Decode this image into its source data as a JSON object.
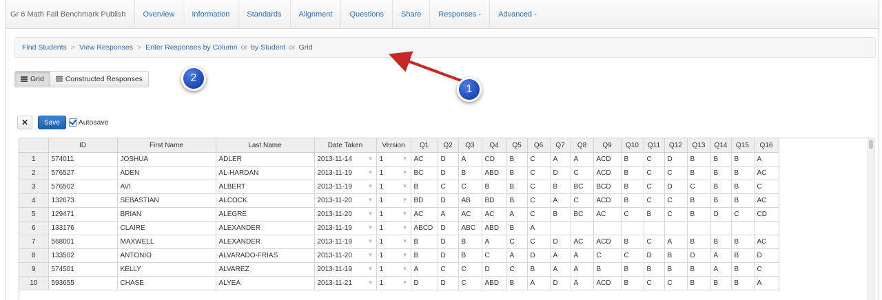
{
  "nav": {
    "title": "Gr 6 Math Fall Benchmark Publish",
    "items": [
      "Overview",
      "Information",
      "Standards",
      "Alignment",
      "Questions",
      "Share",
      "Responses -",
      "Advanced -"
    ]
  },
  "breadcrumb": {
    "find_students": "Find Students",
    "view_responses": "View Responses",
    "enter_by_column": "Enter Responses by Column",
    "or1": "or",
    "by_student": "by Student",
    "or2": "or",
    "grid": "Grid",
    "separator": ">"
  },
  "view_toggle": {
    "grid_label": "Grid",
    "constructed_label": "Constructed Responses"
  },
  "callouts": {
    "one": "1",
    "two": "2"
  },
  "toolbar": {
    "expand_icon": "✕",
    "save_label": "Save",
    "autosave_label": "Autosave",
    "autosave_checked": true
  },
  "grid": {
    "columns": [
      "",
      "ID",
      "First Name",
      "Last Name",
      "Date Taken",
      "Version",
      "Q1",
      "Q2",
      "Q3",
      "Q4",
      "Q5",
      "Q6",
      "Q7",
      "Q8",
      "Q9",
      "Q10",
      "Q11",
      "Q12",
      "Q13",
      "Q14",
      "Q15",
      "Q16"
    ],
    "rows": [
      [
        "1",
        "574011",
        "JOSHUA",
        "ADLER",
        "2013-11-14",
        "1",
        "AC",
        "D",
        "A",
        "CD",
        "B",
        "C",
        "A",
        "A",
        "ACD",
        "B",
        "C",
        "D",
        "B",
        "B",
        "B",
        "A"
      ],
      [
        "2",
        "576527",
        "ADEN",
        "AL-HARDAN",
        "2013-11-19",
        "1",
        "BC",
        "D",
        "B",
        "ABD",
        "B",
        "C",
        "D",
        "C",
        "ACD",
        "B",
        "C",
        "C",
        "B",
        "B",
        "B",
        "AC"
      ],
      [
        "3",
        "576502",
        "AVI",
        "ALBERT",
        "2013-11-19",
        "1",
        "B",
        "C",
        "C",
        "B",
        "B",
        "C",
        "B",
        "BC",
        "BCD",
        "B",
        "C",
        "D",
        "C",
        "B",
        "B",
        "C"
      ],
      [
        "4",
        "132673",
        "SEBASTIAN",
        "ALCOCK",
        "2013-11-20",
        "1",
        "BD",
        "D",
        "AB",
        "BD",
        "B",
        "C",
        "A",
        "C",
        "ACD",
        "B",
        "C",
        "C",
        "B",
        "B",
        "B",
        "AC"
      ],
      [
        "5",
        "129471",
        "BRIAN",
        "ALEGRE",
        "2013-11-20",
        "1",
        "AC",
        "A",
        "AC",
        "AC",
        "A",
        "C",
        "B",
        "BC",
        "AC",
        "C",
        "B",
        "C",
        "B",
        "D",
        "C",
        "CD"
      ],
      [
        "6",
        "133176",
        "CLAIRE",
        "ALEXANDER",
        "2013-11-19",
        "1",
        "ABCD",
        "D",
        "ABC",
        "ABD",
        "B",
        "A",
        "",
        "",
        "",
        "",
        "",
        "",
        "",
        "",
        "",
        ""
      ],
      [
        "7",
        "568001",
        "MAXWELL",
        "ALEXANDER",
        "2013-11-19",
        "1",
        "B",
        "D",
        "B",
        "A",
        "C",
        "C",
        "D",
        "AC",
        "ACD",
        "B",
        "C",
        "A",
        "B",
        "B",
        "B",
        "AC"
      ],
      [
        "8",
        "133502",
        "ANTONIO",
        "ALVARADO-FRIAS",
        "2013-11-20",
        "1",
        "B",
        "D",
        "B",
        "C",
        "A",
        "D",
        "A",
        "A",
        "C",
        "C",
        "D",
        "B",
        "D",
        "A",
        "B",
        "D"
      ],
      [
        "9",
        "574501",
        "KELLY",
        "ALVAREZ",
        "2013-11-19",
        "1",
        "A",
        "C",
        "C",
        "D",
        "C",
        "B",
        "A",
        "A",
        "B",
        "B",
        "B",
        "B",
        "B",
        "A",
        "B",
        "C"
      ],
      [
        "10",
        "593655",
        "CHASE",
        "ALYEA",
        "2013-11-21",
        "1",
        "D",
        "D",
        "C",
        "ABD",
        "B",
        "A",
        "D",
        "A",
        "ACD",
        "B",
        "C",
        "C",
        "B",
        "B",
        "B",
        "A"
      ]
    ]
  }
}
